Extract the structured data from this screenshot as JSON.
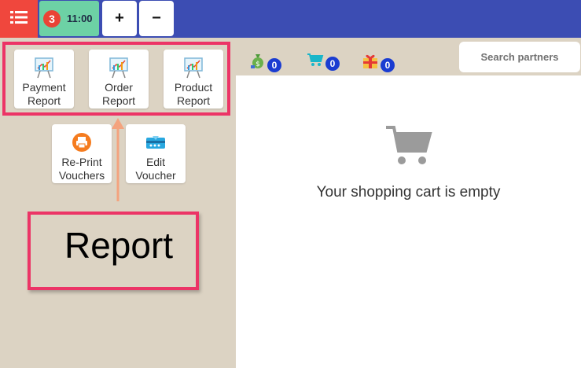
{
  "topbar": {
    "order_count": "3",
    "order_time": "11:00",
    "plus_label": "+",
    "minus_label": "−"
  },
  "counters": {
    "points": "0",
    "cart": "0",
    "gifts": "0"
  },
  "search": {
    "placeholder": "Search partners"
  },
  "tiles": [
    {
      "line1": "Payment",
      "line2": "Report"
    },
    {
      "line1": "Order",
      "line2": "Report"
    },
    {
      "line1": "Product",
      "line2": "Report"
    },
    {
      "line1": "Re-Print",
      "line2": "Vouchers"
    },
    {
      "line1": "Edit",
      "line2": "Voucher"
    }
  ],
  "annotation": {
    "label": "Report"
  },
  "cart": {
    "empty_message": "Your shopping cart is empty"
  },
  "colors": {
    "topbar": "#3c4db3",
    "menu_button": "#f0473d",
    "order_tab": "#6dd1a5",
    "panel": "#dcd3c3",
    "highlight": "#ec3466",
    "arrow": "#f4a37e",
    "badge": "#1a3cd1"
  },
  "icons": [
    "list-icon",
    "chart-icon",
    "printer-icon",
    "voucher-icon",
    "money-bag-icon",
    "cart-icon",
    "gift-icon"
  ]
}
